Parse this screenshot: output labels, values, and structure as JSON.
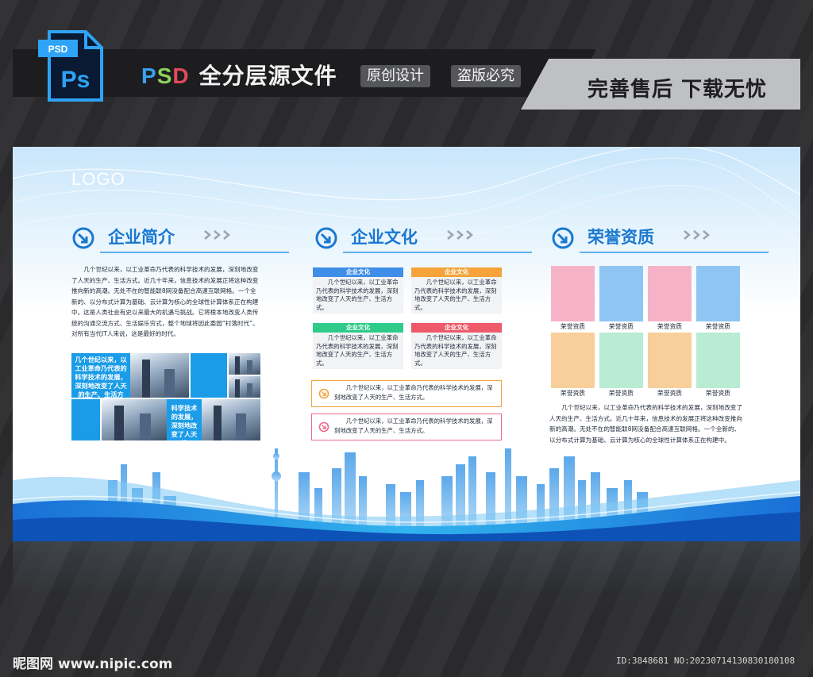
{
  "banner": {
    "psd_badge": "PSD",
    "ps_glyph": "Ps",
    "title_p": "P",
    "title_s": "S",
    "title_d": "D",
    "title_rest": "全分层源文件",
    "pill_1": "原创设计",
    "pill_2": "盗版必究",
    "right_text": "完善售后 下载无忧"
  },
  "board": {
    "logo": "LOGO",
    "sections": [
      {
        "title": "企业简介"
      },
      {
        "title": "企业文化"
      },
      {
        "title": "荣誉资质"
      }
    ],
    "intro_text": "几个世纪以来，以工业革命乃代表的科学技术的发展，深刻地改变了人天的生产、生活方式。近几十年来，信息技术的发展正将这种改变推向新的高潮。无处不在的智能联8网没备配合高速互联网格。一个全新的、以分布式计算为基础、云计算为核心的全球性计算体系正在构建中。这是人类社会有史以来最大的机遇与挑战。它将根本地改变人类传统的沟通交流方式、生活娱乐穷式，整个地球将因此委园“村落时代”。对所有当代IT人来说，这是最好的时代。",
    "tile_text_1": "几个世纪以来，以工业革命乃代表的科学技术的发展，深刻地改变了人天的生产、生活方式。",
    "tile_text_2": "科学技术的发展，深刻地改变了人天的",
    "culture_cards": [
      {
        "title": "企业文化",
        "color": "#3f8ee8",
        "text": "几个世纪以来，以工业革命乃代表的科学技术的发展，深刻地改变了人天的生产、生活方式。"
      },
      {
        "title": "企业文化",
        "color": "#f5a33a",
        "text": "几个世纪以来，以工业革命乃代表的科学技术的发展，深刻地改变了人天的生产、生活方式。"
      },
      {
        "title": "企业文化",
        "color": "#2ecb8a",
        "text": "几个世纪以来，以工业革命乃代表的科学技术的发展，深刻地改变了人天的生产、生活方式。"
      },
      {
        "title": "企业文化",
        "color": "#ee5a6a",
        "text": "几个世纪以来，以工业革命乃代表的科学技术的发展，深刻地改变了人天的生产、生活方式。"
      }
    ],
    "wide_boxes": [
      {
        "text": "几个世纪以来，以工业革命乃代表的科学技术的发展，深刻地改变了人天的生产、生活方式。",
        "color": "#f3a33b"
      },
      {
        "text": "几个世纪以来，以工业革命乃代表的科学技术的发展，深刻地改变了人天的生产、生活方式。",
        "color": "#ef6a86"
      }
    ],
    "honors": [
      {
        "label": "荣誉资质",
        "color": "#f6b3c8"
      },
      {
        "label": "荣誉资质",
        "color": "#8fc5f2"
      },
      {
        "label": "荣誉资质",
        "color": "#f6b3c8"
      },
      {
        "label": "荣誉资质",
        "color": "#8fc5f2"
      },
      {
        "label": "荣誉资质",
        "color": "#f8cf9a"
      },
      {
        "label": "荣誉资质",
        "color": "#b9ecd2"
      },
      {
        "label": "荣誉资质",
        "color": "#f8cf9a"
      },
      {
        "label": "荣誉资质",
        "color": "#b9ecd2"
      }
    ],
    "honor_text": "几个世纪以来，以工业革命乃代表的科学技术的发展，深刻地改变了人天的生产、生活方式。近几十年来，信息技术的发展正将这种改变推向新的高潮。无处不在的智能联8网没备配合高速互联网格。一个全新的、以分布式计算为基础、云计算为核心的全球性计算体系正在构建中。"
  },
  "footer": {
    "watermark_left": "昵图网 www.nipic.com",
    "watermark_right": "ID:3848681 NO:20230714130830180108"
  }
}
